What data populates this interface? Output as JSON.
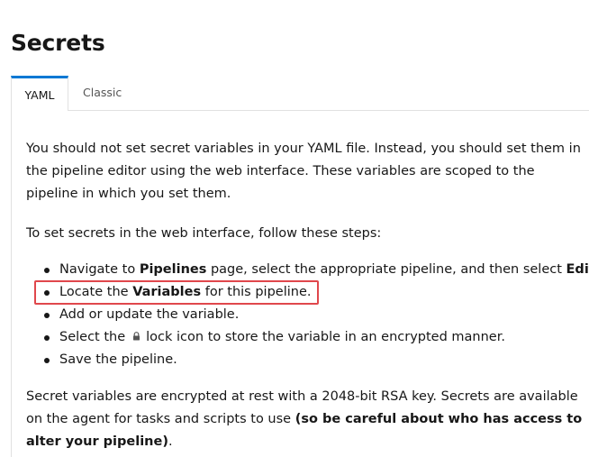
{
  "page": {
    "title": "Secrets"
  },
  "tabs": [
    {
      "label": "YAML",
      "active": true
    },
    {
      "label": "Classic",
      "active": false
    }
  ],
  "content": {
    "intro": "You should not set secret variables in your YAML file. Instead, you should set them in the pipeline editor using the web interface. These variables are scoped to the pipeline in which you set them.",
    "steps_intro": "To set secrets in the web interface, follow these steps:",
    "steps": [
      {
        "pre": "Navigate to ",
        "b1": "Pipelines",
        "mid": " page, select the appropriate pipeline, and then select ",
        "b2": "Edit",
        "post": "."
      },
      {
        "pre": "Locate the ",
        "b1": "Variables",
        "post": " for this pipeline."
      },
      {
        "text": "Add or update the variable."
      },
      {
        "pre": "Select the",
        "icon": "lock-icon",
        "post": "lock icon to store the variable in an encrypted manner."
      },
      {
        "text": "Save the pipeline."
      }
    ],
    "footer_text": "Secret variables are encrypted at rest with a 2048-bit RSA key. Secrets are available on the agent for tasks and scripts to use ",
    "footer_bold": "(so be careful about who has access to alter your pipeline)",
    "footer_end": "."
  },
  "colors": {
    "accent": "#0078d4",
    "highlight": "#e0474c"
  }
}
